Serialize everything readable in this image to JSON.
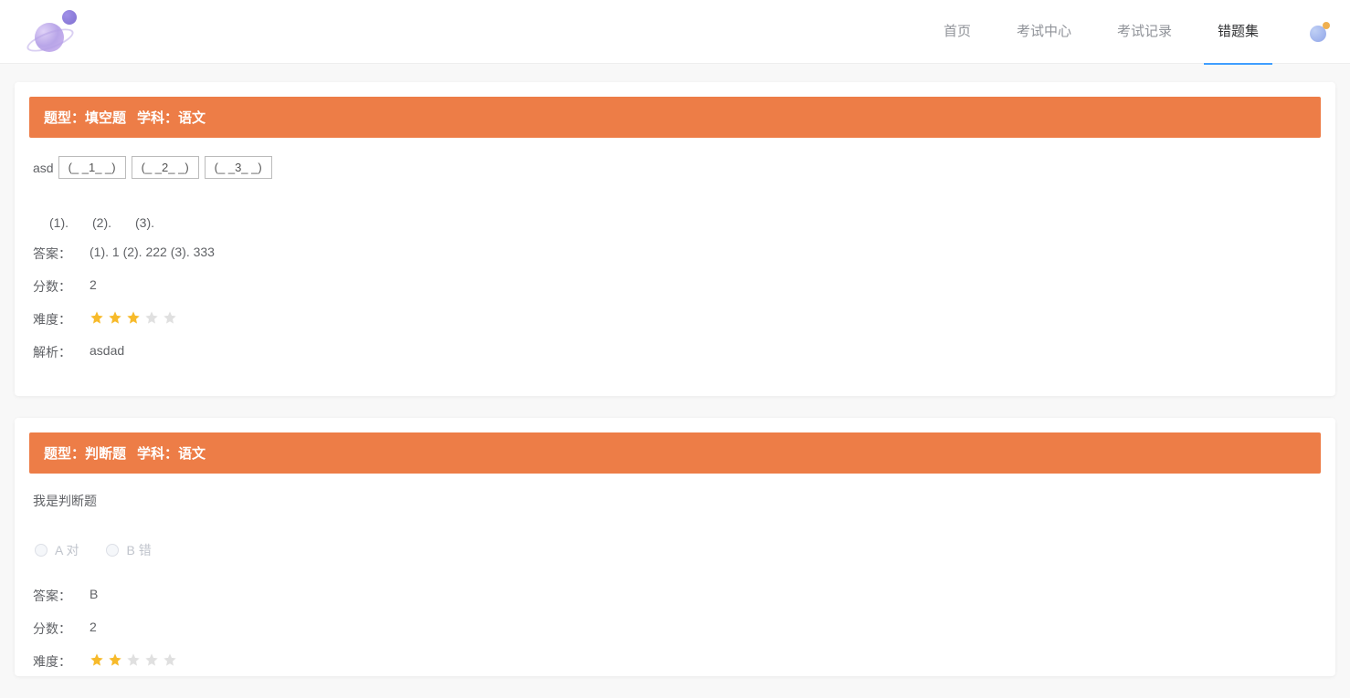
{
  "nav": {
    "items": [
      {
        "label": "首页",
        "active": false
      },
      {
        "label": "考试中心",
        "active": false
      },
      {
        "label": "考试记录",
        "active": false
      },
      {
        "label": "错题集",
        "active": true
      }
    ]
  },
  "labels": {
    "type_prefix": "题型：",
    "subject_prefix": "学科：",
    "answer": "答案：",
    "score": "分数：",
    "difficulty": "难度：",
    "analysis": "解析："
  },
  "questions": [
    {
      "type": "填空题",
      "subject": "语文",
      "stemPrefix": "asd",
      "blanks": [
        "(_ _1_ _)",
        "(_ _2_ _)",
        "(_ _3_ _)"
      ],
      "userBlanks": [
        "(1). ",
        "(2). ",
        "(3). "
      ],
      "answer": "(1). 1  (2). 222  (3). 333",
      "score": "2",
      "difficulty": 3,
      "analysis": "asdad"
    },
    {
      "type": "判断题",
      "subject": "语文",
      "stem": "我是判断题",
      "options": [
        {
          "label": "A 对"
        },
        {
          "label": "B 错"
        }
      ],
      "answer": "B",
      "score": "2",
      "difficulty": 2
    }
  ]
}
